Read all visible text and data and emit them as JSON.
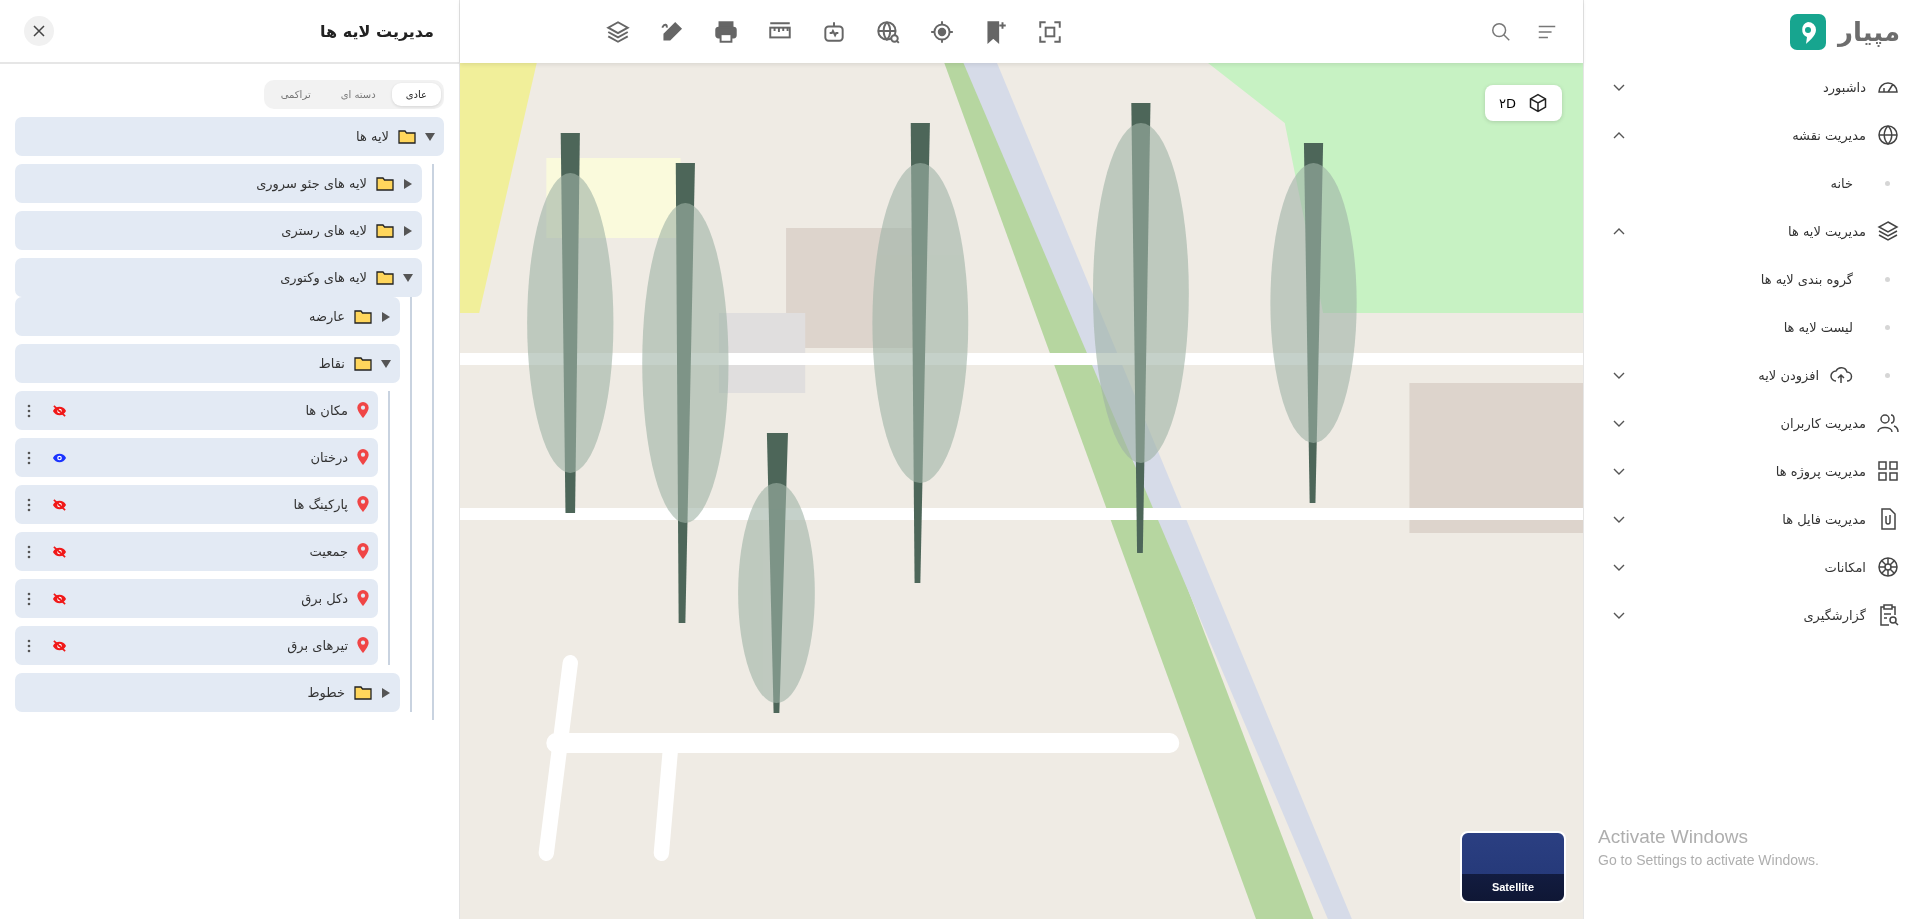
{
  "panel": {
    "title": "مدیریت لایه ها",
    "view_tabs": [
      {
        "label": "عادی",
        "selected": true
      },
      {
        "label": "دسته ای",
        "selected": false
      },
      {
        "label": "تراکمی",
        "selected": false
      }
    ],
    "tree": [
      {
        "kind": "folder",
        "label": "لایه ها",
        "expanded": true,
        "children": [
          {
            "kind": "folder",
            "label": "لایه های جئو سروری",
            "expanded": false
          },
          {
            "kind": "folder",
            "label": "لایه های رستری",
            "expanded": false
          },
          {
            "kind": "folder",
            "label": "لایه های وکتوری",
            "expanded": true,
            "children": [
              {
                "kind": "folder",
                "label": "عارضه",
                "expanded": false
              },
              {
                "kind": "folder",
                "label": "نقاط",
                "expanded": true,
                "children": [
                  {
                    "kind": "layer",
                    "label": "مکان ها",
                    "visible": false
                  },
                  {
                    "kind": "layer",
                    "label": "درختان",
                    "visible": true
                  },
                  {
                    "kind": "layer",
                    "label": "پارکینگ ها",
                    "visible": false
                  },
                  {
                    "kind": "layer",
                    "label": "جمعیت",
                    "visible": false
                  },
                  {
                    "kind": "layer",
                    "label": "دکل برق",
                    "visible": false
                  },
                  {
                    "kind": "layer",
                    "label": "تیرهای برق",
                    "visible": false
                  }
                ]
              },
              {
                "kind": "folder",
                "label": "خطوط",
                "expanded": false
              }
            ]
          }
        ]
      }
    ]
  },
  "map": {
    "mode_button": "۲D",
    "basemap_label": "Satellite"
  },
  "sidebar": {
    "brand": "مپیار",
    "items": [
      {
        "label": "داشبورد",
        "expanded": false
      },
      {
        "label": "مدیریت نقشه",
        "expanded": true,
        "children": [
          {
            "kind": "link",
            "label": "خانه"
          }
        ]
      },
      {
        "label": "مدیریت لایه ها",
        "expanded": true,
        "children": [
          {
            "kind": "link",
            "label": "گروه بندی لایه ها"
          },
          {
            "kind": "link",
            "label": "لیست لایه ها"
          },
          {
            "kind": "group",
            "label": "افزودن لایه",
            "expanded": false
          }
        ]
      },
      {
        "label": "مدیریت کاربران",
        "expanded": false
      },
      {
        "label": "مدیریت پروژه ها",
        "expanded": false
      },
      {
        "label": "مدیریت فایل ها",
        "expanded": false
      },
      {
        "label": "امکانات",
        "expanded": false
      },
      {
        "label": "گزارشگیری",
        "expanded": false
      }
    ]
  },
  "os_notice": {
    "title": "Activate Windows",
    "text": "Go to Settings to activate Windows."
  }
}
